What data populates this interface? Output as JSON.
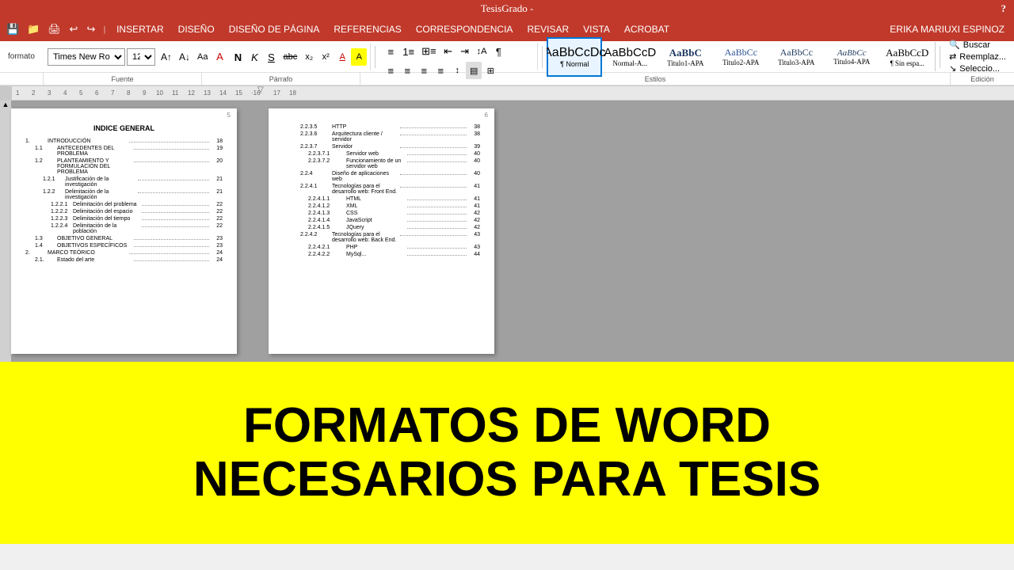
{
  "titleBar": {
    "title": "TesisGrado -",
    "help": "?"
  },
  "menuBar": {
    "items": [
      "INSERTAR",
      "DISEÑO",
      "DISEÑO DE PÁGINA",
      "REFERENCIAS",
      "CORRESPONDENCIA",
      "REVISAR",
      "VISTA",
      "ACROBAT"
    ],
    "user": "ERIKA MARIUXI ESPINOZ"
  },
  "toolbar1": {
    "fontName": "Times New Ro",
    "fontSize": "12",
    "formatLabel": "¶ formato",
    "bold": "N",
    "italic": "K",
    "underline": "S",
    "strikethrough": "abc",
    "subscript": "x₂",
    "superscript": "x²"
  },
  "toolbar2": {
    "fuente": "Fuente",
    "parrafo": "Párrafo",
    "estilos": "Estilos",
    "edicion": "Edición"
  },
  "styles": {
    "items": [
      {
        "label": "¶ Normal",
        "preview": "AaBbCcDc",
        "active": true
      },
      {
        "label": "Normal-A...",
        "preview": "AaBbCcD"
      },
      {
        "label": "Titulo1-APA",
        "preview": "AaBbC"
      },
      {
        "label": "Titulo2-APA",
        "preview": "AaBbCc"
      },
      {
        "label": "Titulo3-APA",
        "preview": "AaBbCc"
      },
      {
        "label": "Titulo4-APA",
        "preview": "AaBbCc"
      },
      {
        "label": "¶ Sin espa...",
        "preview": "AaBbCcD"
      }
    ]
  },
  "editing": {
    "search": "Buscar",
    "replace": "Reemplaz...",
    "select": "Seleccio..."
  },
  "page5": {
    "number": "5",
    "title": "INDICE GENERAL",
    "entries": [
      {
        "num": "1.",
        "text": "INTRODUCCIÓN",
        "page": "18",
        "indent": 0
      },
      {
        "num": "1.1",
        "text": "ANTECEDENTES DEL PROBLEMA",
        "page": "19",
        "indent": 1
      },
      {
        "num": "1.2",
        "text": "PLANTEAMIENTO Y FORMULACIÓN DEL PROBLEMA",
        "page": "20",
        "indent": 1
      },
      {
        "num": "1.2.1",
        "text": "Justificación de la investigación",
        "page": "21",
        "indent": 2
      },
      {
        "num": "1.2.2",
        "text": "Delimitación de la investigación",
        "page": "21",
        "indent": 2
      },
      {
        "num": "1.2.2.1",
        "text": "Delimitación del problema",
        "page": "22",
        "indent": 3
      },
      {
        "num": "1.2.2.2",
        "text": "Delimitación del espacio",
        "page": "22",
        "indent": 3
      },
      {
        "num": "1.2.2.3",
        "text": "Delimitación del tiempo",
        "page": "22",
        "indent": 3
      },
      {
        "num": "1.2.2.4",
        "text": "Delimitación de la población",
        "page": "22",
        "indent": 3
      },
      {
        "num": "1.3",
        "text": "OBJETIVO GENERAL",
        "page": "23",
        "indent": 1
      },
      {
        "num": "1.4",
        "text": "OBJETIVOS ESPECÍFICOS",
        "page": "23",
        "indent": 1
      },
      {
        "num": "2.",
        "text": "MARCO TEÓRICO",
        "page": "24",
        "indent": 0
      },
      {
        "num": "2.1.",
        "text": "Estado del arte",
        "page": "24",
        "indent": 1
      }
    ]
  },
  "page6": {
    "number": "6",
    "entries": [
      {
        "num": "2.2.3.5",
        "text": "HTTP",
        "page": "38"
      },
      {
        "num": "2.2.3.6",
        "text": "Arquitectura cliente / servidor",
        "page": "38"
      },
      {
        "num": "2.2.3.7",
        "text": "Servidor",
        "page": "39"
      },
      {
        "num": "2.2.3.7.1",
        "text": "Servidor web",
        "page": "40"
      },
      {
        "num": "2.2.3.7.2",
        "text": "Funcionamiento de un servidor web",
        "page": "40"
      },
      {
        "num": "2.2.4",
        "text": "Diseño de aplicaciones web",
        "page": "40"
      },
      {
        "num": "2.2.4.1",
        "text": "Tecnologías para el desarrollo web: Front End.",
        "page": "41"
      },
      {
        "num": "2.2.4.1.1",
        "text": "HTML",
        "page": "41"
      },
      {
        "num": "2.2.4.1.2",
        "text": "XML",
        "page": "41"
      },
      {
        "num": "2.2.4.1.3",
        "text": "CSS",
        "page": "42"
      },
      {
        "num": "2.2.4.1.4",
        "text": "JavaScript",
        "page": "42"
      },
      {
        "num": "2.2.4.1.5",
        "text": "JQuery",
        "page": "42"
      },
      {
        "num": "2.2.4.2",
        "text": "Tecnologías para el desarrollo web: Back End.",
        "page": "43"
      },
      {
        "num": "2.2.4.2.1",
        "text": "PHP",
        "page": "43"
      },
      {
        "num": "2.2.4.2.2",
        "text": "MySql...",
        "page": "44"
      }
    ]
  },
  "banner": {
    "line1": "FORMATOS DE WORD",
    "line2": "NECESARIOS PARA TESIS"
  }
}
